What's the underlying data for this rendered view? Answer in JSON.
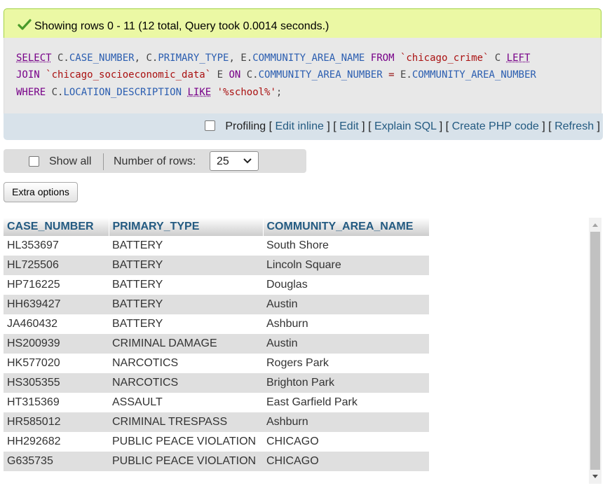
{
  "success": {
    "message": "Showing rows 0 - 11 (12 total, Query took 0.0014 seconds.)",
    "accent": "#ebf8a4"
  },
  "sql": {
    "line1": [
      {
        "t": "SELECT",
        "c": "kwu"
      },
      {
        "t": " C.",
        "c": "plain"
      },
      {
        "t": "CASE_NUMBER",
        "c": "id"
      },
      {
        "t": ", C.",
        "c": "plain"
      },
      {
        "t": "PRIMARY_TYPE",
        "c": "id"
      },
      {
        "t": ", E.",
        "c": "plain"
      },
      {
        "t": "COMMUNITY_AREA_NAME",
        "c": "id"
      },
      {
        "t": " ",
        "c": "plain"
      },
      {
        "t": "FROM",
        "c": "kw"
      },
      {
        "t": " ",
        "c": "plain"
      },
      {
        "t": "`chicago_crime`",
        "c": "str"
      },
      {
        "t": " C ",
        "c": "plain"
      },
      {
        "t": "LEFT",
        "c": "kwu"
      }
    ],
    "line2": [
      {
        "t": "JOIN",
        "c": "kw"
      },
      {
        "t": " ",
        "c": "plain"
      },
      {
        "t": "`chicago_socioeconomic_data`",
        "c": "str"
      },
      {
        "t": " E ",
        "c": "plain"
      },
      {
        "t": "ON",
        "c": "kw"
      },
      {
        "t": " C.",
        "c": "plain"
      },
      {
        "t": "COMMUNITY_AREA_NUMBER",
        "c": "id"
      },
      {
        "t": " ",
        "c": "plain"
      },
      {
        "t": "=",
        "c": "op"
      },
      {
        "t": " E.",
        "c": "plain"
      },
      {
        "t": "COMMUNITY_AREA_NUMBER",
        "c": "id"
      }
    ],
    "line3": [
      {
        "t": "WHERE",
        "c": "kw"
      },
      {
        "t": " C.",
        "c": "plain"
      },
      {
        "t": "LOCATION_DESCRIPTION",
        "c": "id"
      },
      {
        "t": " ",
        "c": "plain"
      },
      {
        "t": "LIKE",
        "c": "kwu"
      },
      {
        "t": " ",
        "c": "plain"
      },
      {
        "t": "'%school%'",
        "c": "str"
      },
      {
        "t": ";",
        "c": "plain"
      }
    ]
  },
  "toolbar": {
    "profiling": "Profiling",
    "bracket_open": "[",
    "bracket_close": "]",
    "edit_inline": "Edit inline",
    "edit": "Edit",
    "explain": "Explain SQL",
    "create_php": "Create PHP code",
    "refresh": "Refresh"
  },
  "nav": {
    "show_all": "Show all",
    "rows_label": "Number of rows:",
    "rows_value": "25"
  },
  "extra_options": "Extra options",
  "table": {
    "headers": [
      "CASE_NUMBER",
      "PRIMARY_TYPE",
      "COMMUNITY_AREA_NAME"
    ],
    "rows": [
      [
        "HL353697",
        "BATTERY",
        "South Shore"
      ],
      [
        "HL725506",
        "BATTERY",
        "Lincoln Square"
      ],
      [
        "HP716225",
        "BATTERY",
        "Douglas"
      ],
      [
        "HH639427",
        "BATTERY",
        "Austin"
      ],
      [
        "JA460432",
        "BATTERY",
        "Ashburn"
      ],
      [
        "HS200939",
        "CRIMINAL DAMAGE",
        "Austin"
      ],
      [
        "HK577020",
        "NARCOTICS",
        "Rogers Park"
      ],
      [
        "HS305355",
        "NARCOTICS",
        "Brighton Park"
      ],
      [
        "HT315369",
        "ASSAULT",
        "East Garfield Park"
      ],
      [
        "HR585012",
        "CRIMINAL TRESPASS",
        "Ashburn"
      ],
      [
        "HH292682",
        "PUBLIC PEACE VIOLATION",
        "CHICAGO"
      ],
      [
        "G635735",
        "PUBLIC PEACE VIOLATION",
        "CHICAGO"
      ]
    ]
  }
}
